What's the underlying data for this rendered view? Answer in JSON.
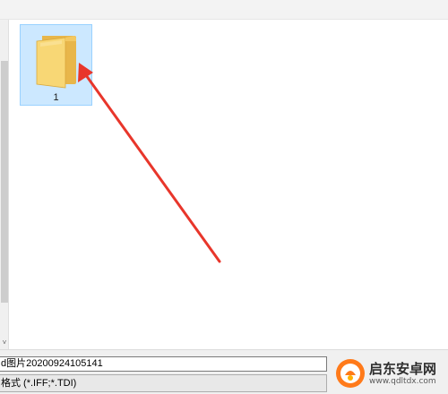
{
  "file_area": {
    "items": [
      {
        "name": "1",
        "type": "folder",
        "selected": true
      }
    ]
  },
  "annotation": {
    "arrow_color": "#e8362b"
  },
  "bottom": {
    "filename_value": "d图片20200924105141",
    "filetype_value": "格式 (*.IFF;*.TDI)"
  },
  "watermark": {
    "text": "启东安卓网",
    "url": "www.qdltdx.com"
  },
  "colors": {
    "selection_bg": "#cce8ff",
    "selection_border": "#99d1ff",
    "folder_yellow": "#f8d775"
  }
}
